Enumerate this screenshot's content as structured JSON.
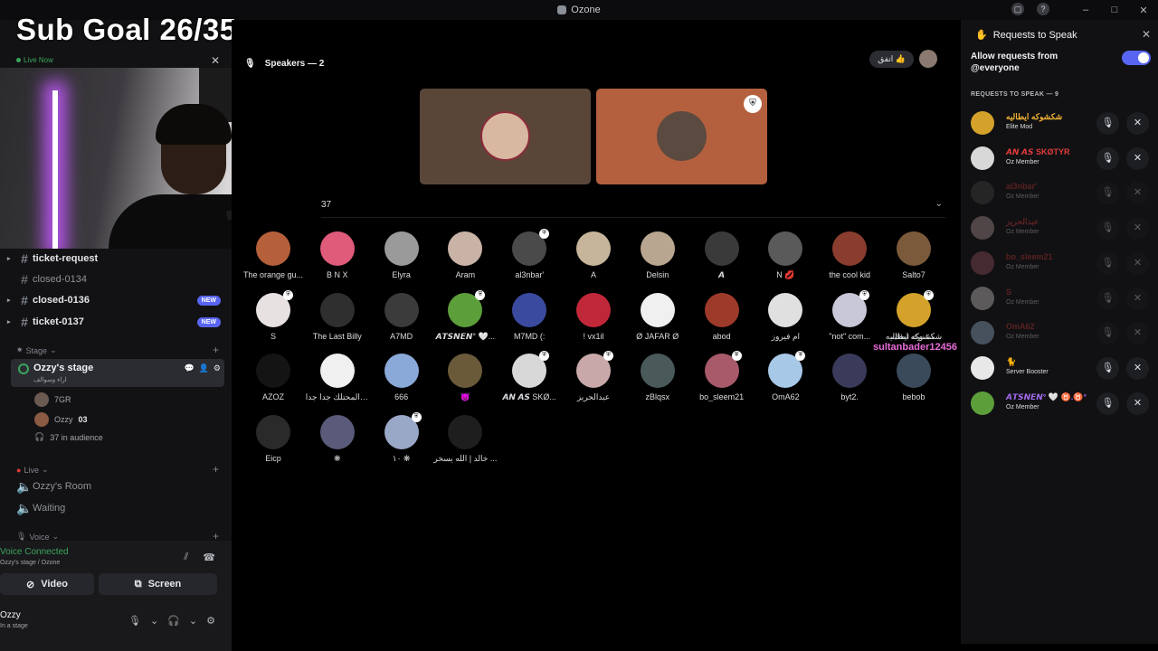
{
  "window": {
    "title": "Ozone",
    "controls": [
      "–",
      "□",
      "✕"
    ]
  },
  "overlay": {
    "sub_goal": "Sub Goal 26/35",
    "live_now": "Live Now",
    "floating_name": "sultanbader12456",
    "floating_small": "شكشوكه ايطاليه"
  },
  "sidebar": {
    "channels": [
      {
        "label": "ticket-request",
        "bright": true
      },
      {
        "label": "closed-0134",
        "bright": false
      },
      {
        "label": "closed-0136",
        "bright": true,
        "badge": "NEW"
      },
      {
        "label": "ticket-0137",
        "bright": true,
        "badge": "NEW"
      }
    ],
    "cat_stage": "Stage",
    "stage_name": "Ozzy's stage",
    "stage_sub": "اراء وسوالف",
    "stage_members": [
      {
        "name": "7GR"
      },
      {
        "name": "Ozzy",
        "extra": "03"
      },
      {
        "name": "37 in audience"
      }
    ],
    "cat_live": "Live",
    "live_channels": [
      "Ozzy's Room",
      "Waiting"
    ],
    "cat_voice": "Voice"
  },
  "voice": {
    "title": "Voice Connected",
    "sub": "Ozzy's stage / Ozone",
    "video_label": "Video",
    "screen_label": "Screen",
    "user_name": "Ozzy",
    "user_status": "In a stage"
  },
  "main": {
    "speakers_header": "Speakers — 2",
    "pill_text": "اتفق 👍",
    "audience_count": "37",
    "audience": [
      {
        "name": "The orange gu...",
        "color": "#b5603a",
        "mod": false
      },
      {
        "name": "B N X",
        "color": "#e05a7a",
        "mod": false
      },
      {
        "name": "Elyra",
        "color": "#9a9a9a",
        "mod": false
      },
      {
        "name": "Aram",
        "color": "#c9b2a6",
        "mod": false
      },
      {
        "name": "al3nbar'",
        "color": "#4a4a4a",
        "mod": true
      },
      {
        "name": "A",
        "color": "#c6b59a",
        "mod": false
      },
      {
        "name": "Delsin",
        "color": "#b9a690",
        "mod": false
      },
      {
        "name": "𝘼",
        "color": "#3a3a3a",
        "mod": false
      },
      {
        "name": "N 💋",
        "color": "#5a5a5a",
        "mod": false
      },
      {
        "name": "the cool kid",
        "color": "#8a3d2f",
        "mod": false
      },
      {
        "name": "Salto7",
        "color": "#7a5a3a",
        "mod": false
      },
      {
        "name": "S",
        "color": "#e8e1e1",
        "mod": true
      },
      {
        "name": "The Last Billy",
        "color": "#2f2f2f",
        "mod": false
      },
      {
        "name": "A7MD",
        "color": "#3b3b3b",
        "mod": false
      },
      {
        "name": "𝘼𝙏𝙎𝙉𝙀𝙉° 🤍...",
        "color": "#5c9e3a",
        "mod": true
      },
      {
        "name": "M7MD (:",
        "color": "#3a4a9e",
        "mod": false
      },
      {
        "name": "! vx1il",
        "color": "#c0283a",
        "mod": false
      },
      {
        "name": "Ø JAFAR Ø",
        "color": "#f0f0f0",
        "mod": false
      },
      {
        "name": "abod",
        "color": "#9e3a2a",
        "mod": false
      },
      {
        "name": "ام فيروز",
        "color": "#e0e0e0",
        "mod": false
      },
      {
        "name": "\"not\" com...",
        "color": "#c8c8d8",
        "mod": true
      },
      {
        "name": "شكشوكه ايطاليه",
        "color": "#d4a22a",
        "mod": true
      },
      {
        "name": "AZOZ",
        "color": "#141414",
        "mod": false
      },
      {
        "name": "ون المحتلك جدا جدا",
        "color": "#f0f0f0",
        "mod": false
      },
      {
        "name": "666",
        "color": "#8aa8d8",
        "mod": false
      },
      {
        "name": "👿",
        "color": "#6a5a3a",
        "mod": false
      },
      {
        "name": "𝘼𝙉 𝘼𝙎 SKØ...",
        "color": "#d8d8d8",
        "mod": true
      },
      {
        "name": "عبدالحريز",
        "color": "#c8a8a8",
        "mod": true
      },
      {
        "name": "zBlqsx",
        "color": "#4a5a5a",
        "mod": false
      },
      {
        "name": "bo_sleem21",
        "color": "#a85a6a",
        "mod": true
      },
      {
        "name": "OmA62",
        "color": "#a8c8e8",
        "mod": true
      },
      {
        "name": "byt2.",
        "color": "#3a3a5a",
        "mod": false
      },
      {
        "name": "bebob",
        "color": "#3a4a5a",
        "mod": false
      },
      {
        "name": "Eicp",
        "color": "#2a2a2a",
        "mod": false
      },
      {
        "name": "❋",
        "color": "#5a5a7a",
        "mod": false
      },
      {
        "name": "١٠ ❋",
        "color": "#9aa8c8",
        "mod": true
      },
      {
        "name": "خالد | الله يسخر ...",
        "color": "#1e1e1e",
        "mod": false
      }
    ]
  },
  "requests": {
    "title": "Requests to Speak",
    "allow_text": "Allow requests from @everyone",
    "header": "REQUESTS TO SPEAK — 9",
    "items": [
      {
        "name": "شكشوكه ايطاليه",
        "role": "Elite Mod",
        "name_color": "#f0b232",
        "av": "#d4a22a",
        "dim": false
      },
      {
        "name": "𝘼𝙉 𝘼𝙎 SKØTYR",
        "role": "Oz Member",
        "name_color": "#e03c3c",
        "av": "#d8d8d8",
        "dim": false
      },
      {
        "name": "al3nbar'",
        "role": "Oz Member",
        "name_color": "#e03c3c",
        "av": "#4a4a4a",
        "dim": true
      },
      {
        "name": "عبدالحريز",
        "role": "Oz Member",
        "name_color": "#e03c3c",
        "av": "#c8a8a8",
        "dim": true
      },
      {
        "name": "bo_sleem21",
        "role": "Oz Member",
        "name_color": "#e03c3c",
        "av": "#a85a6a",
        "dim": true
      },
      {
        "name": "S",
        "role": "Oz Member",
        "name_color": "#e03c3c",
        "av": "#e8e1e1",
        "dim": true
      },
      {
        "name": "OmA62",
        "role": "Oz Member",
        "name_color": "#e03c3c",
        "av": "#a8c8e8",
        "dim": true
      },
      {
        "name": "🐈",
        "role": "Server Booster",
        "name_color": "#e86bd8",
        "av": "#e8e8e8",
        "dim": false
      },
      {
        "name": "𝘼𝙏𝙎𝙉𝙀𝙉° 🤍 ♉.♉°",
        "role": "Oz Member",
        "name_color": "#a46bf0",
        "av": "#5c9e3a",
        "dim": false
      }
    ]
  }
}
